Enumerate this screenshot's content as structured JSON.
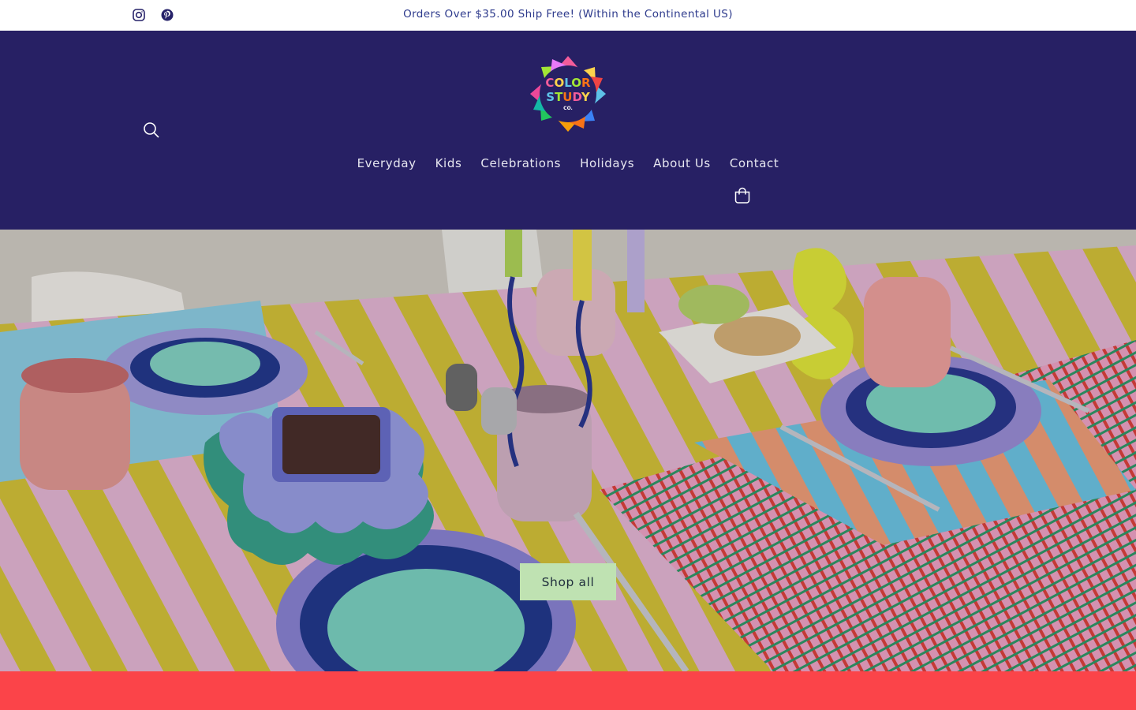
{
  "announcement": {
    "text": "Orders Over $35.00 Ship Free! (Within the Continental US)"
  },
  "social": {
    "icons": [
      "instagram-icon",
      "pinterest-icon"
    ]
  },
  "header": {
    "logo_lines": [
      "COLOR",
      "STUDY",
      "CO."
    ],
    "nav": [
      {
        "label": "Everyday"
      },
      {
        "label": "Kids"
      },
      {
        "label": "Celebrations"
      },
      {
        "label": "Holidays"
      },
      {
        "label": "About Us"
      },
      {
        "label": "Contact"
      }
    ],
    "icons": [
      "search-icon",
      "cart-icon"
    ]
  },
  "hero": {
    "button_label": "Shop all"
  },
  "colors": {
    "header_bg": "#272064",
    "announcement_text": "#2d3a8c",
    "button_bg": "#bfe2b2",
    "band_bg": "#fb4449"
  }
}
